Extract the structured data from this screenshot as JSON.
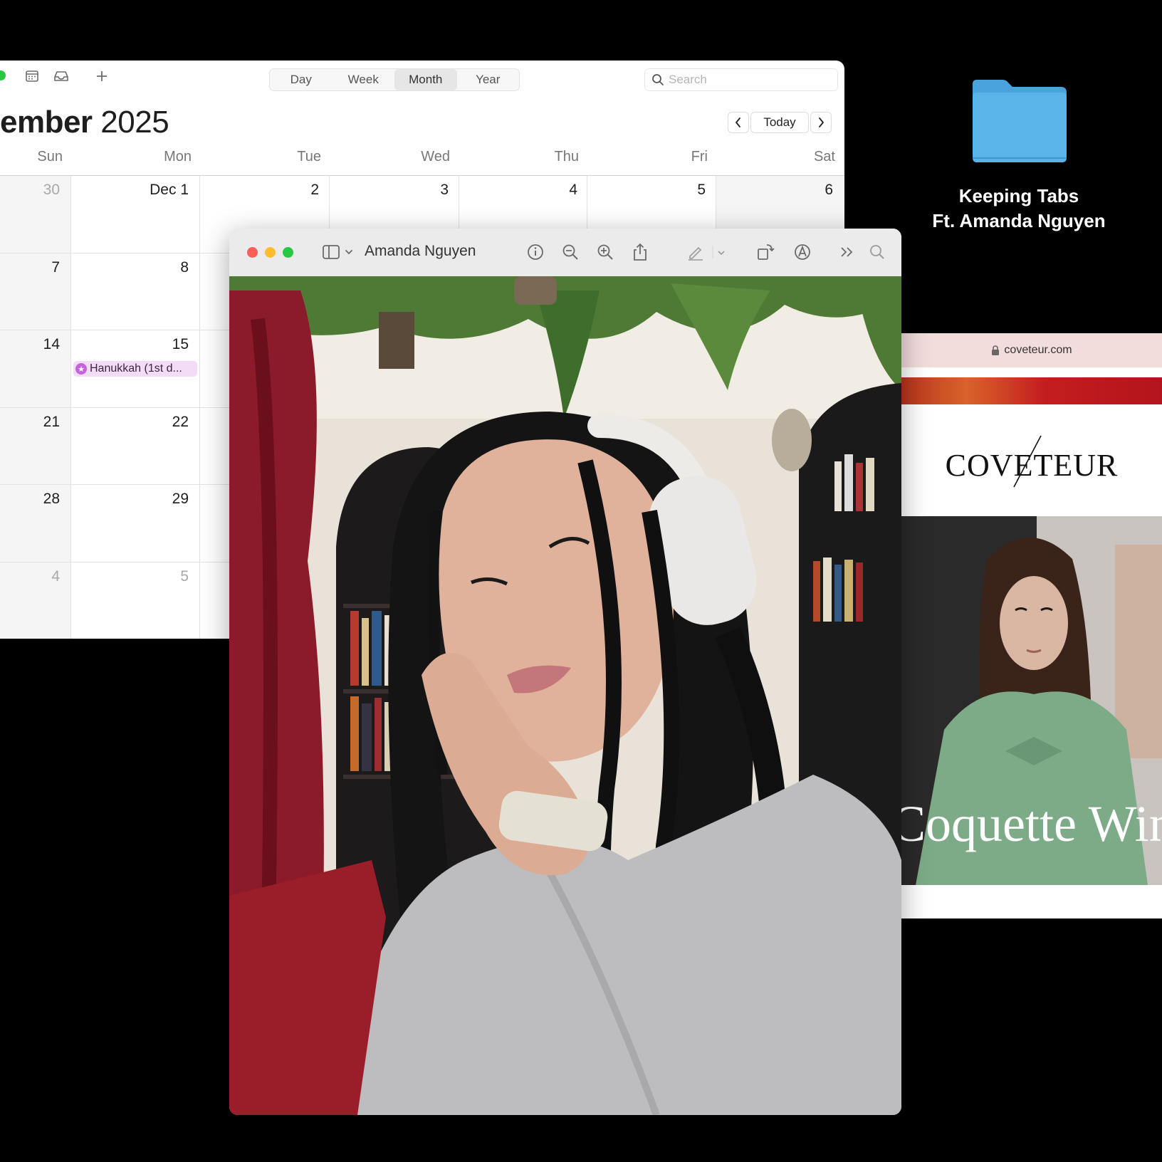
{
  "calendar": {
    "title_bold": "cember",
    "title_year": "2025",
    "views": [
      "Day",
      "Week",
      "Month",
      "Year"
    ],
    "active_view": "Month",
    "search_placeholder": "Search",
    "today_label": "Today",
    "weekdays": [
      "Sun",
      "Mon",
      "Tue",
      "Wed",
      "Thu",
      "Fri",
      "Sat"
    ],
    "weeks": [
      [
        "30",
        "Dec 1",
        "2",
        "3",
        "4",
        "5",
        "6"
      ],
      [
        "7",
        "8"
      ],
      [
        "14",
        "15"
      ],
      [
        "21",
        "22"
      ],
      [
        "28",
        "29"
      ],
      [
        "4",
        "5"
      ]
    ],
    "event": "Hanukkah (1st d..."
  },
  "folder": {
    "line1": "Keeping Tabs",
    "line2": "Ft. Amanda Nguyen",
    "color": "#5ab4ea"
  },
  "preview": {
    "title": "Amanda Nguyen"
  },
  "browser": {
    "url": "coveteur.com",
    "logo": "COVETEUR",
    "headline": "Coquette Win"
  }
}
